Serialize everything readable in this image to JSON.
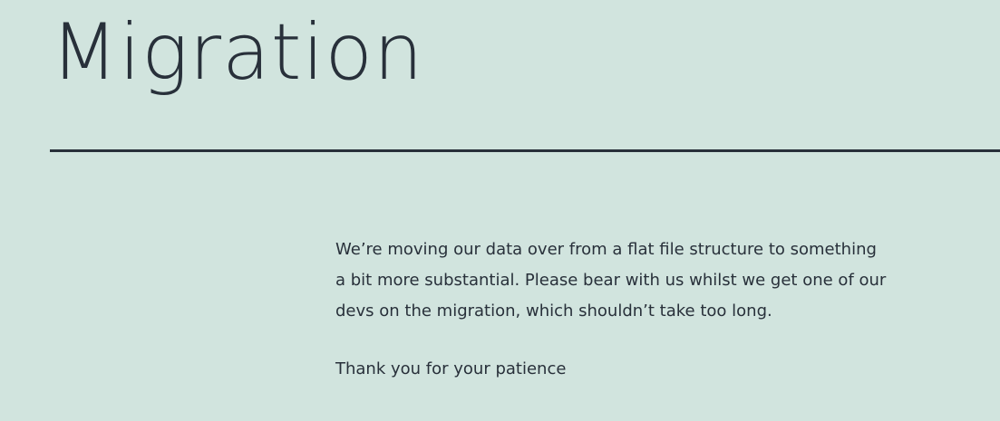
{
  "page": {
    "title": "Migration",
    "body_text": "We’re moving our data over from a flat file structure to something a bit more substantial. Please bear with us whilst we get one of our devs on the migration, which shouldn’t take too long.",
    "closing_text": "Thank you for your patience"
  },
  "colors": {
    "background": "#d1e4de",
    "text": "#28303a",
    "divider": "#28303a"
  }
}
